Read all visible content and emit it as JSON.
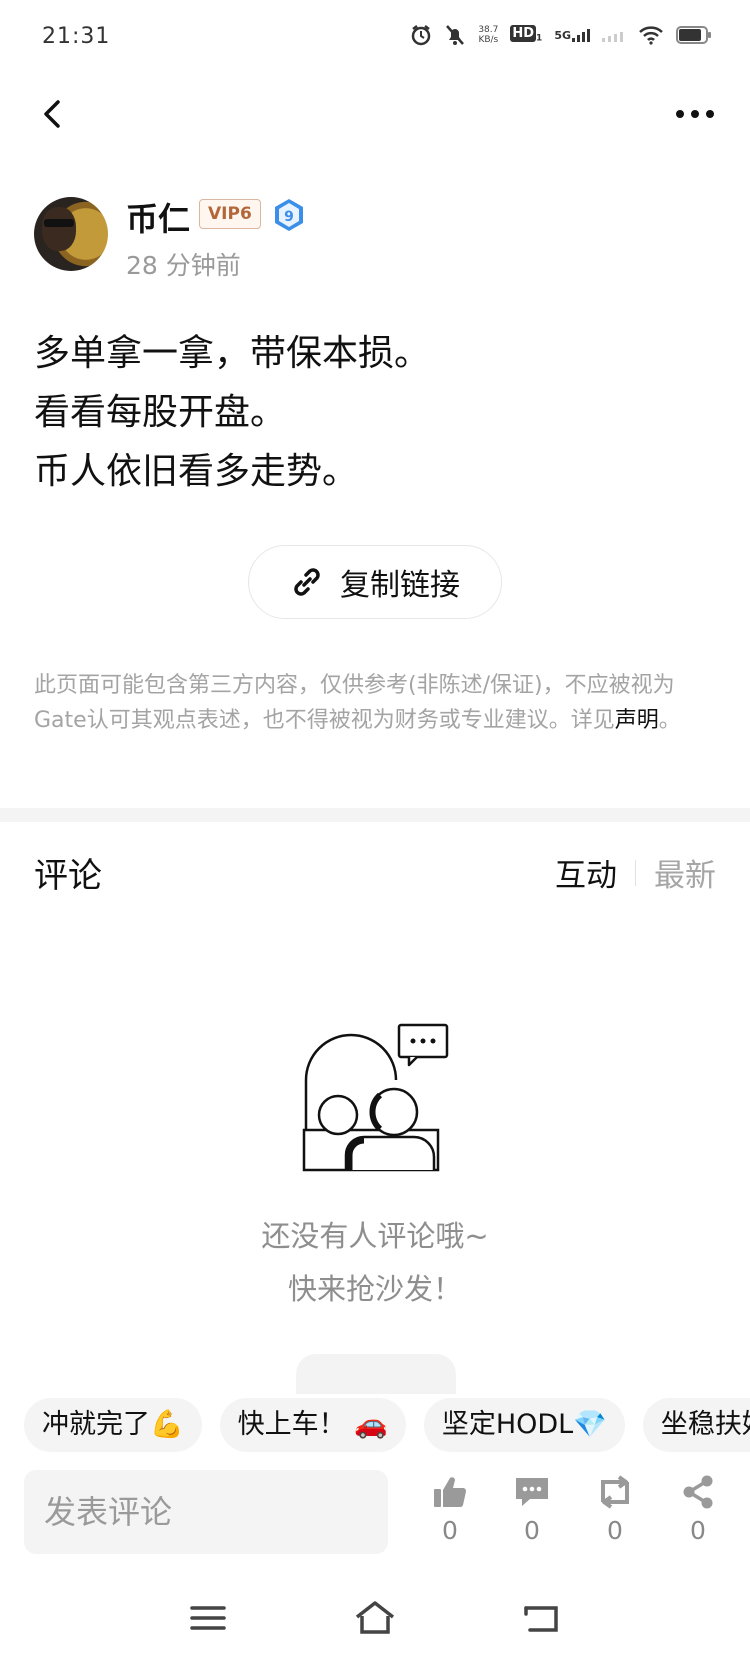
{
  "status_bar": {
    "time": "21:31",
    "net_speed_value": "38.7",
    "net_speed_unit": "KB/s",
    "hd_label": "HD",
    "hd_sub": "1",
    "network": "5G",
    "icons": [
      "alarm-icon",
      "mute-icon",
      "signal-icon",
      "wifi-icon",
      "battery-icon"
    ]
  },
  "nav": {
    "icons": [
      "back-icon",
      "more-icon"
    ]
  },
  "post": {
    "author": "币仁",
    "vip": "VIP6",
    "level": "9",
    "time_ago": "28 分钟前",
    "lines": [
      "多单拿一拿，带保本损。",
      "看看每股开盘。",
      "币人依旧看多走势。"
    ],
    "copy_link_label": "复制链接",
    "disclaimer_text": "此页面可能包含第三方内容，仅供参考(非陈述/保证)，不应被视为Gate认可其观点表述，也不得被视为财务或专业建议。详见",
    "disclaimer_link": "声明",
    "disclaimer_end": "。"
  },
  "comments": {
    "title": "评论",
    "sort_tabs": [
      "互动",
      "最新"
    ],
    "empty_line1": "还没有人评论哦~",
    "empty_line2": "快来抢沙发！"
  },
  "quick_replies": [
    "冲就完了💪",
    "快上车！ 🚗",
    "坚定HODL💎",
    "坐稳扶好"
  ],
  "action_bar": {
    "input_placeholder": "发表评论",
    "actions": [
      {
        "icon": "like-icon",
        "count": "0"
      },
      {
        "icon": "comment-icon",
        "count": "0"
      },
      {
        "icon": "repost-icon",
        "count": "0"
      },
      {
        "icon": "share-icon",
        "count": "0"
      }
    ]
  },
  "colors": {
    "text": "#111111",
    "muted": "#9a9a9a",
    "chip_bg": "#f4f4f4",
    "vip_text": "#b3663a",
    "level_badge": "#3b8fe8"
  }
}
